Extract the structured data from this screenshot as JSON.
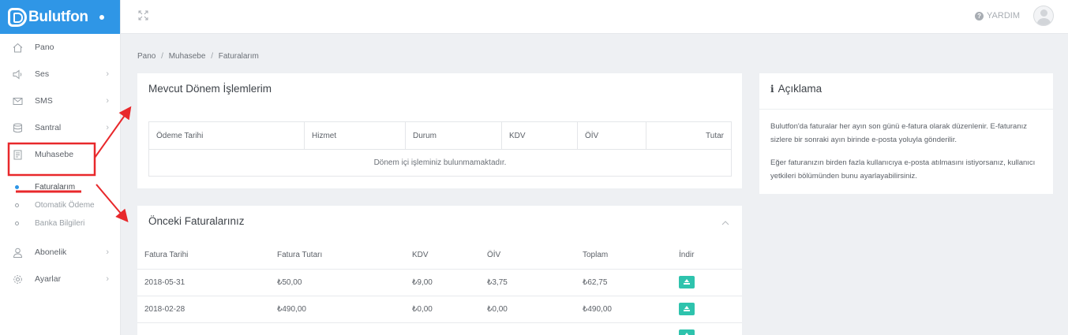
{
  "brand": {
    "name": "Bulutfon"
  },
  "sidebar": {
    "items": [
      {
        "label": "Pano",
        "icon": "home-icon",
        "chevron": false
      },
      {
        "label": "Ses",
        "icon": "speaker-icon",
        "chevron": true
      },
      {
        "label": "SMS",
        "icon": "mail-icon",
        "chevron": true
      },
      {
        "label": "Santral",
        "icon": "database-icon",
        "chevron": true
      },
      {
        "label": "Muhasebe",
        "icon": "document-icon",
        "chevron": false
      }
    ],
    "subitems": [
      {
        "label": "Faturalarım",
        "active": true
      },
      {
        "label": "Otomatik Ödeme",
        "active": false
      },
      {
        "label": "Banka Bilgileri",
        "active": false
      }
    ],
    "items_after": [
      {
        "label": "Abonelik",
        "icon": "user-icon",
        "chevron": true
      },
      {
        "label": "Ayarlar",
        "icon": "gear-icon",
        "chevron": true
      }
    ]
  },
  "topbar": {
    "help_label": "YARDIM"
  },
  "breadcrumb": [
    "Pano",
    "Muhasebe",
    "Faturalarım"
  ],
  "current_period": {
    "title": "Mevcut Dönem İşlemlerim",
    "columns": [
      "Ödeme Tarihi",
      "Hizmet",
      "Durum",
      "KDV",
      "ÖİV",
      "Tutar"
    ],
    "empty_message": "Dönem içi işleminiz bulunmamaktadır."
  },
  "previous_invoices": {
    "title": "Önceki Faturalarınız",
    "columns": [
      "Fatura Tarihi",
      "Fatura Tutarı",
      "KDV",
      "ÖİV",
      "Toplam",
      "İndir"
    ],
    "rows": [
      {
        "date": "2018-05-31",
        "amount": "₺50,00",
        "kdv": "₺9,00",
        "oiv": "₺3,75",
        "total": "₺62,75"
      },
      {
        "date": "2018-02-28",
        "amount": "₺490,00",
        "kdv": "₺0,00",
        "oiv": "₺0,00",
        "total": "₺490,00"
      }
    ]
  },
  "info": {
    "title": "Açıklama",
    "paragraph1": "Bulutfon'da faturalar her ayın son günü e-fatura olarak düzenlenir. E-faturanız sizlere bir sonraki ayın birinde e-posta yoluyla gönderilir.",
    "paragraph2": "Eğer faturanızın birden fazla kullanıcıya e-posta atılmasını istiyorsanız, kullanıcı yetkileri bölümünden bunu ayarlayabilirsiniz."
  },
  "colors": {
    "brand": "#2f96e6",
    "download_button": "#2ec3ad",
    "annotation": "#e8282b"
  }
}
